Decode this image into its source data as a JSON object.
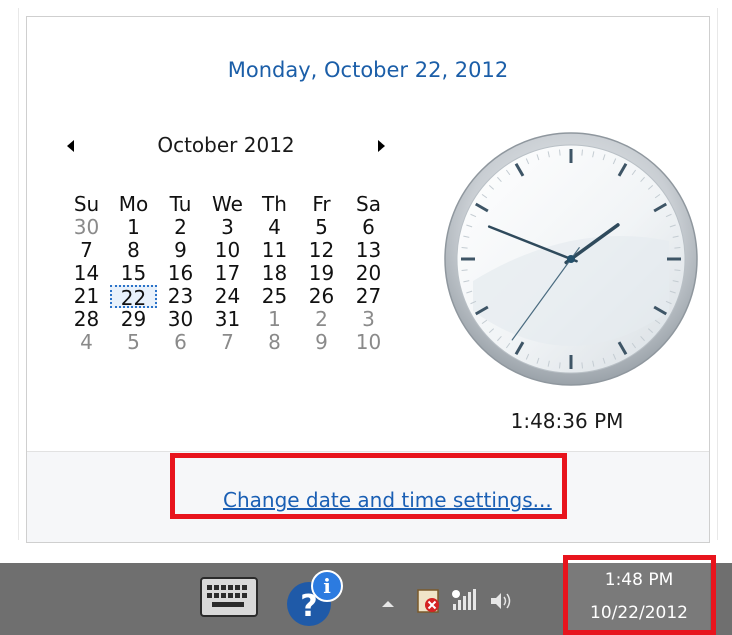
{
  "flyout": {
    "long_date": "Monday, October 22, 2012",
    "calendar": {
      "month_title": "October 2012",
      "weekdays": [
        "Su",
        "Mo",
        "Tu",
        "We",
        "Th",
        "Fr",
        "Sa"
      ],
      "weeks": [
        [
          {
            "d": "30",
            "other": true
          },
          {
            "d": "1"
          },
          {
            "d": "2"
          },
          {
            "d": "3"
          },
          {
            "d": "4"
          },
          {
            "d": "5"
          },
          {
            "d": "6"
          }
        ],
        [
          {
            "d": "7"
          },
          {
            "d": "8"
          },
          {
            "d": "9"
          },
          {
            "d": "10"
          },
          {
            "d": "11"
          },
          {
            "d": "12"
          },
          {
            "d": "13"
          }
        ],
        [
          {
            "d": "14"
          },
          {
            "d": "15"
          },
          {
            "d": "16"
          },
          {
            "d": "17"
          },
          {
            "d": "18"
          },
          {
            "d": "19"
          },
          {
            "d": "20"
          }
        ],
        [
          {
            "d": "21"
          },
          {
            "d": "22",
            "today": true
          },
          {
            "d": "23"
          },
          {
            "d": "24"
          },
          {
            "d": "25"
          },
          {
            "d": "26"
          },
          {
            "d": "27"
          }
        ],
        [
          {
            "d": "28"
          },
          {
            "d": "29"
          },
          {
            "d": "30"
          },
          {
            "d": "31"
          },
          {
            "d": "1",
            "other": true
          },
          {
            "d": "2",
            "other": true
          },
          {
            "d": "3",
            "other": true
          }
        ],
        [
          {
            "d": "4",
            "other": true
          },
          {
            "d": "5",
            "other": true
          },
          {
            "d": "6",
            "other": true
          },
          {
            "d": "7",
            "other": true
          },
          {
            "d": "8",
            "other": true
          },
          {
            "d": "9",
            "other": true
          },
          {
            "d": "10",
            "other": true
          }
        ]
      ]
    },
    "clock": {
      "hour": 1,
      "minute": 48,
      "second": 36
    },
    "digital_time": "1:48:36 PM",
    "change_settings_link": "Change date and time settings..."
  },
  "taskbar": {
    "icons": [
      "keyboard-icon",
      "help-icon",
      "show-hidden-icons-arrow",
      "action-center-icon",
      "network-icon",
      "volume-icon"
    ],
    "tray_time": "1:48 PM",
    "tray_date": "10/22/2012"
  },
  "colors": {
    "highlight_box": "#e8141d",
    "link": "#1a5fb4",
    "date_heading": "#1b5ea8",
    "taskbar": "#6f6f6f"
  }
}
